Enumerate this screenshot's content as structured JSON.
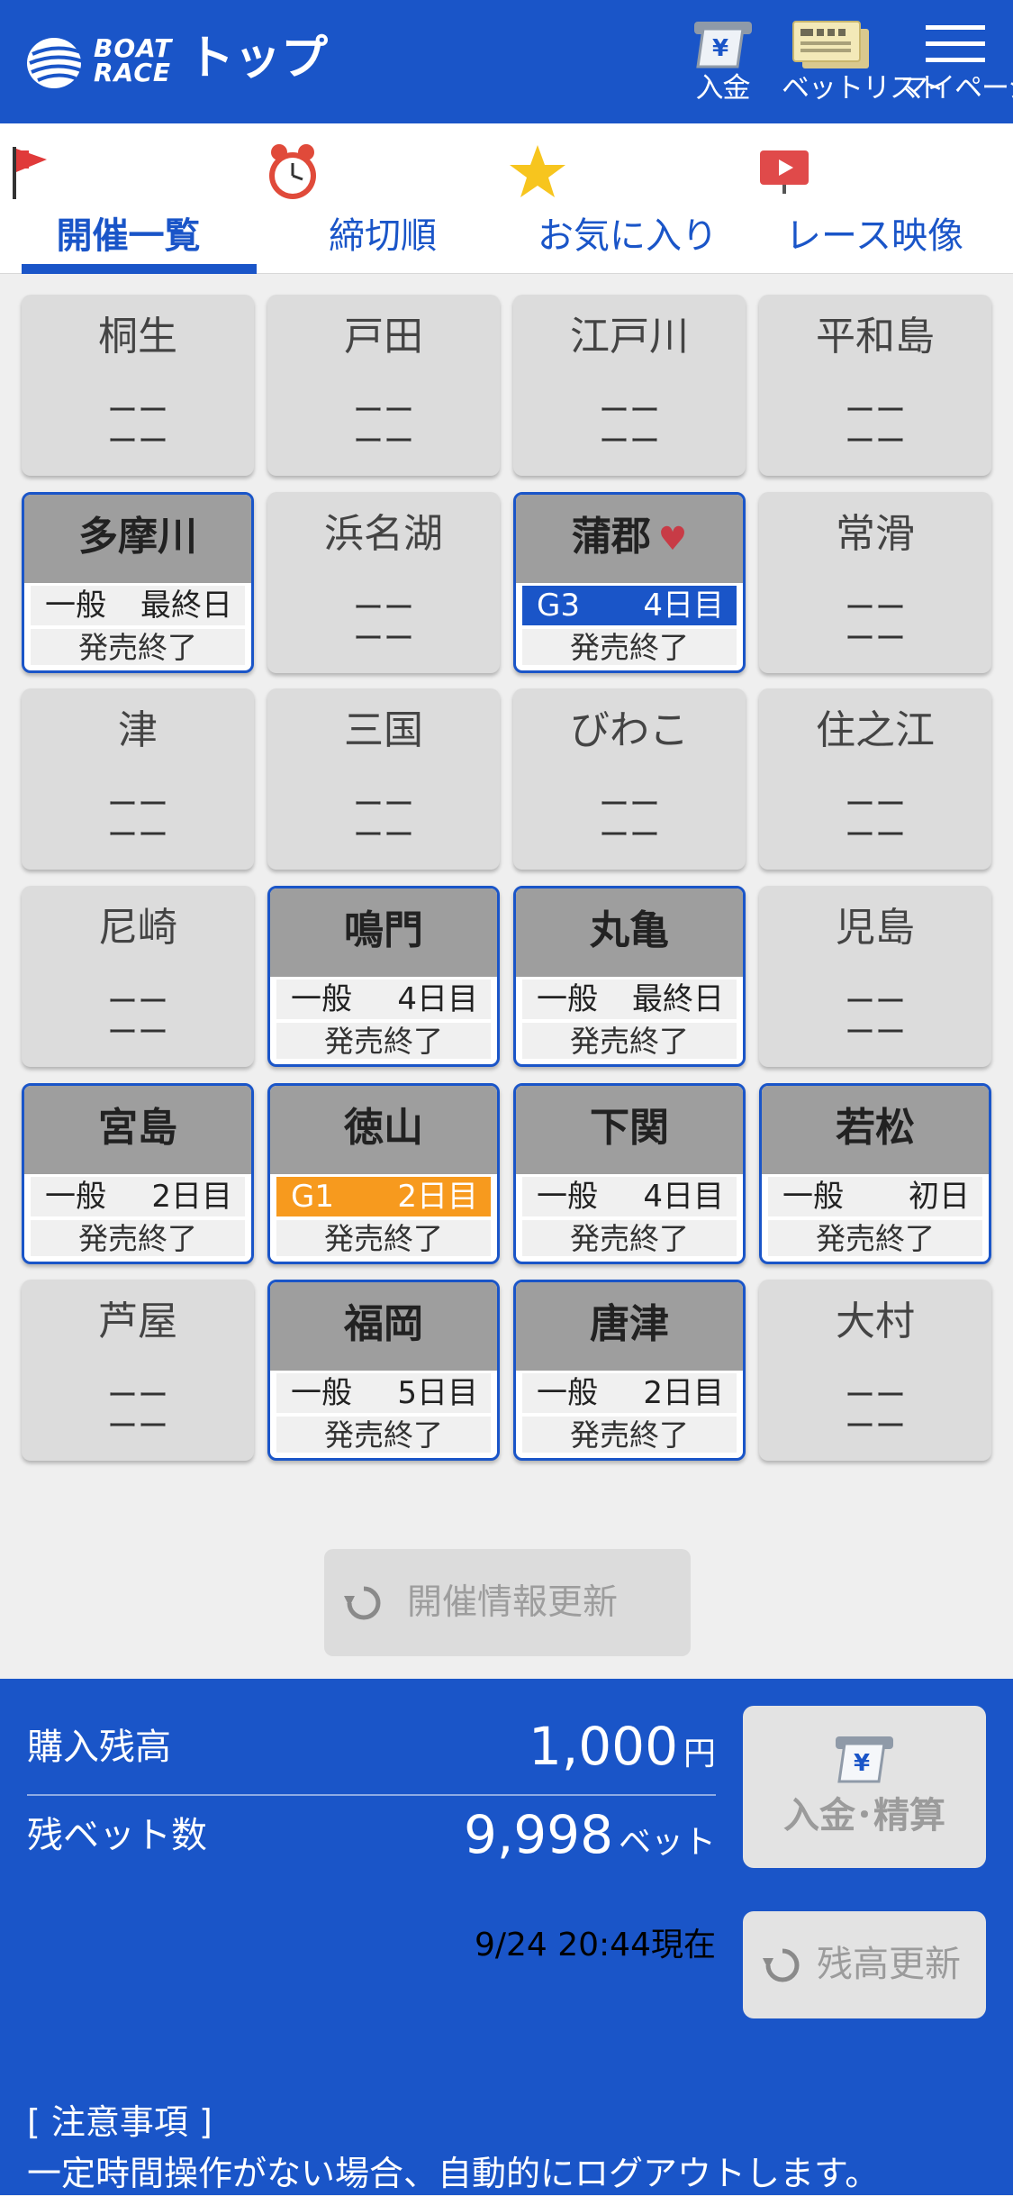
{
  "header": {
    "title": "トップ",
    "logo_line1": "BOAT",
    "logo_line2": "RACE",
    "deposit_label": "入金",
    "betlist_label": "ベットリスト",
    "mypage_label": "マイページ"
  },
  "tabs": [
    {
      "label": "開催一覧",
      "icon": "flag-icon",
      "active": true
    },
    {
      "label": "締切順",
      "icon": "alarm-clock-icon",
      "active": false
    },
    {
      "label": "お気に入り",
      "icon": "star-icon",
      "active": false
    },
    {
      "label": "レース映像",
      "icon": "video-icon",
      "active": false
    }
  ],
  "venues": [
    {
      "name": "桐生",
      "dash": "ーー"
    },
    {
      "name": "戸田",
      "dash": "ーー"
    },
    {
      "name": "江戸川",
      "dash": "ーー"
    },
    {
      "name": "平和島",
      "dash": "ーー"
    },
    {
      "name": "多摩川",
      "grade": "一般",
      "day": "最終日",
      "status": "発売終了"
    },
    {
      "name": "浜名湖",
      "dash": "ーー"
    },
    {
      "name": "蒲郡",
      "grade": "G3",
      "day": "4日目",
      "status": "発売終了",
      "favorite": true
    },
    {
      "name": "常滑",
      "dash": "ーー"
    },
    {
      "name": "津",
      "dash": "ーー"
    },
    {
      "name": "三国",
      "dash": "ーー"
    },
    {
      "name": "びわこ",
      "dash": "ーー"
    },
    {
      "name": "住之江",
      "dash": "ーー"
    },
    {
      "name": "尼崎",
      "dash": "ーー"
    },
    {
      "name": "鳴門",
      "grade": "一般",
      "day": "4日目",
      "status": "発売終了"
    },
    {
      "name": "丸亀",
      "grade": "一般",
      "day": "最終日",
      "status": "発売終了"
    },
    {
      "name": "児島",
      "dash": "ーー"
    },
    {
      "name": "宮島",
      "grade": "一般",
      "day": "2日目",
      "status": "発売終了"
    },
    {
      "name": "徳山",
      "grade": "G1",
      "day": "2日目",
      "status": "発売終了"
    },
    {
      "name": "下関",
      "grade": "一般",
      "day": "4日目",
      "status": "発売終了"
    },
    {
      "name": "若松",
      "grade": "一般",
      "day": "初日",
      "status": "発売終了"
    },
    {
      "name": "芦屋",
      "dash": "ーー"
    },
    {
      "name": "福岡",
      "grade": "一般",
      "day": "5日目",
      "status": "発売終了"
    },
    {
      "name": "唐津",
      "grade": "一般",
      "day": "2日目",
      "status": "発売終了"
    },
    {
      "name": "大村",
      "dash": "ーー"
    }
  ],
  "refresh_label": "開催情報更新",
  "balance": {
    "purchase_label": "購入残高",
    "purchase_value": "1,000",
    "purchase_unit": "円",
    "bets_label": "残ベット数",
    "bets_value": "9,998",
    "bets_unit": "ベット",
    "deposit_settle_label": "入金･精算",
    "timestamp": "9/24 20:44現在",
    "balance_refresh_label": "残高更新"
  },
  "notice": {
    "title": "[ 注意事項 ]",
    "text": "一定時間操作がない場合、自動的にログアウトします。"
  },
  "colors": {
    "brand_blue": "#1a55c8",
    "g1_orange": "#f79a1e",
    "favorite_red": "#c83b46"
  }
}
